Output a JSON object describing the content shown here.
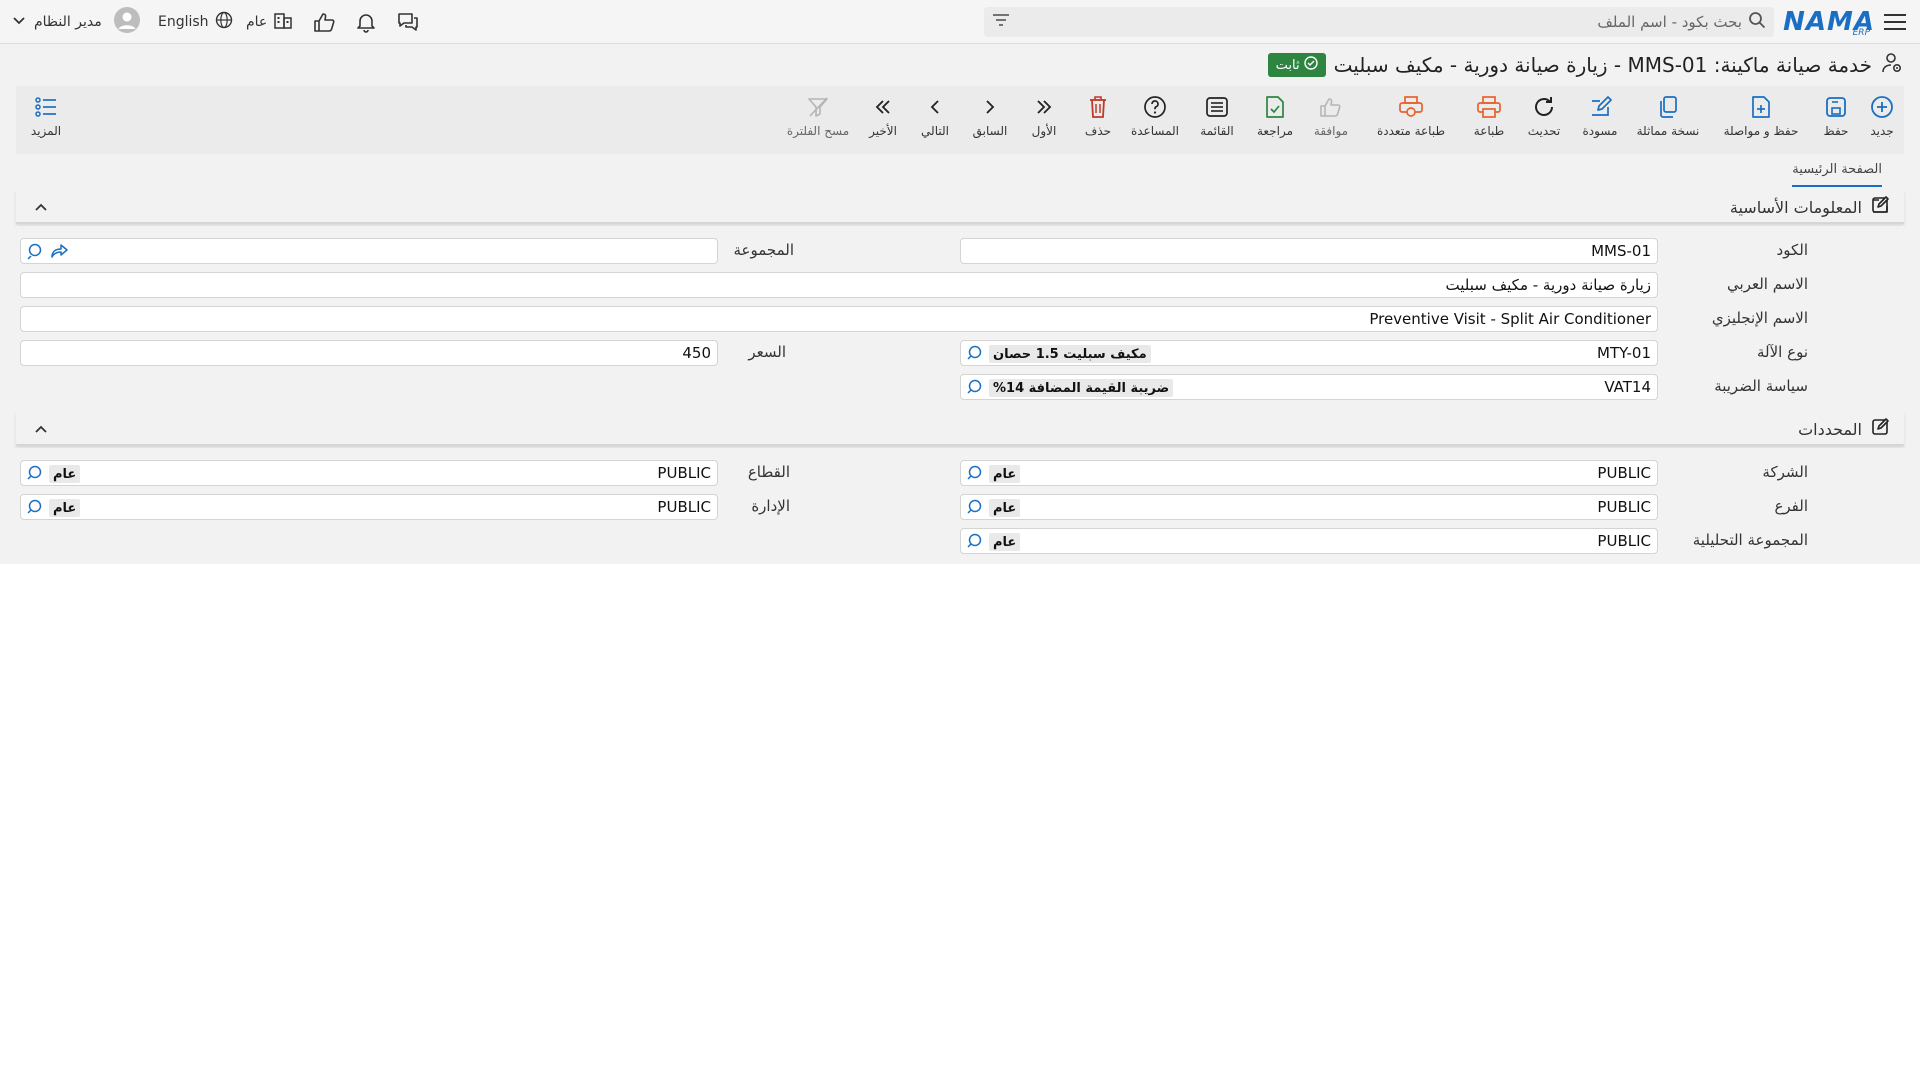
{
  "header": {
    "logo_text": "NAMA",
    "logo_sub": "ERP",
    "search_placeholder": "بحث بكود - اسم الملف",
    "language_label": "English",
    "user_name": "مدير النظام",
    "scope_label": "عام"
  },
  "title": {
    "text": "خدمة صيانة ماكينة: MMS-01 - زيارة صيانة دورية - مكيف سبليت",
    "status": "ثابت"
  },
  "toolbar": {
    "new": "جديد",
    "save": "حفظ",
    "save_continue": "حفظ و مواصلة",
    "duplicate": "نسخة مماثلة",
    "draft": "مسودة",
    "refresh": "تحديث",
    "print": "طباعة",
    "multi_print": "طباعة متعددة",
    "approve": "موافقة",
    "review": "مراجعة",
    "list": "القائمة",
    "help": "المساعدة",
    "delete": "حذف",
    "first": "الأول",
    "previous": "السابق",
    "next": "التالي",
    "last": "الأخير",
    "clear_filter": "مسح الفلترة",
    "more": "المزيد"
  },
  "tabs": {
    "home": "الصفحة الرئيسية"
  },
  "basic_info": {
    "title": "المعلومات الأساسية",
    "code_label": "الكود",
    "code_value": "MMS-01",
    "group_label": "المجموعة",
    "group_value": "",
    "arabic_name_label": "الاسم العربي",
    "arabic_name_value": "زيارة صيانة دورية - مكيف سبليت",
    "english_name_label": "الاسم الإنجليزي",
    "english_name_value": "Preventive Visit - Split Air Conditioner",
    "machine_type_label": "نوع الآلة",
    "machine_type_code": "MTY-01",
    "machine_type_name": "مكيف سبليت 1.5 حصان",
    "price_label": "السعر",
    "price_value": "450",
    "tax_policy_label": "سياسة الضريبة",
    "tax_policy_code": "VAT14",
    "tax_policy_name": "ضريبة القيمة المضافة 14%"
  },
  "determinants": {
    "title": "المحددات",
    "company_label": "الشركة",
    "company_code": "PUBLIC",
    "company_name": "عام",
    "sector_label": "القطاع",
    "sector_code": "PUBLIC",
    "sector_name": "عام",
    "branch_label": "الفرع",
    "branch_code": "PUBLIC",
    "branch_name": "عام",
    "department_label": "الإدارة",
    "department_code": "PUBLIC",
    "department_name": "عام",
    "analytic_group_label": "المجموعة التحليلية",
    "analytic_group_code": "PUBLIC",
    "analytic_group_name": "عام"
  },
  "colors": {
    "brand": "#1a6fc4",
    "status_green": "#2e8540",
    "print_orange": "#e8622c",
    "delete_red": "#c0392b",
    "review_green": "#2e8540"
  }
}
